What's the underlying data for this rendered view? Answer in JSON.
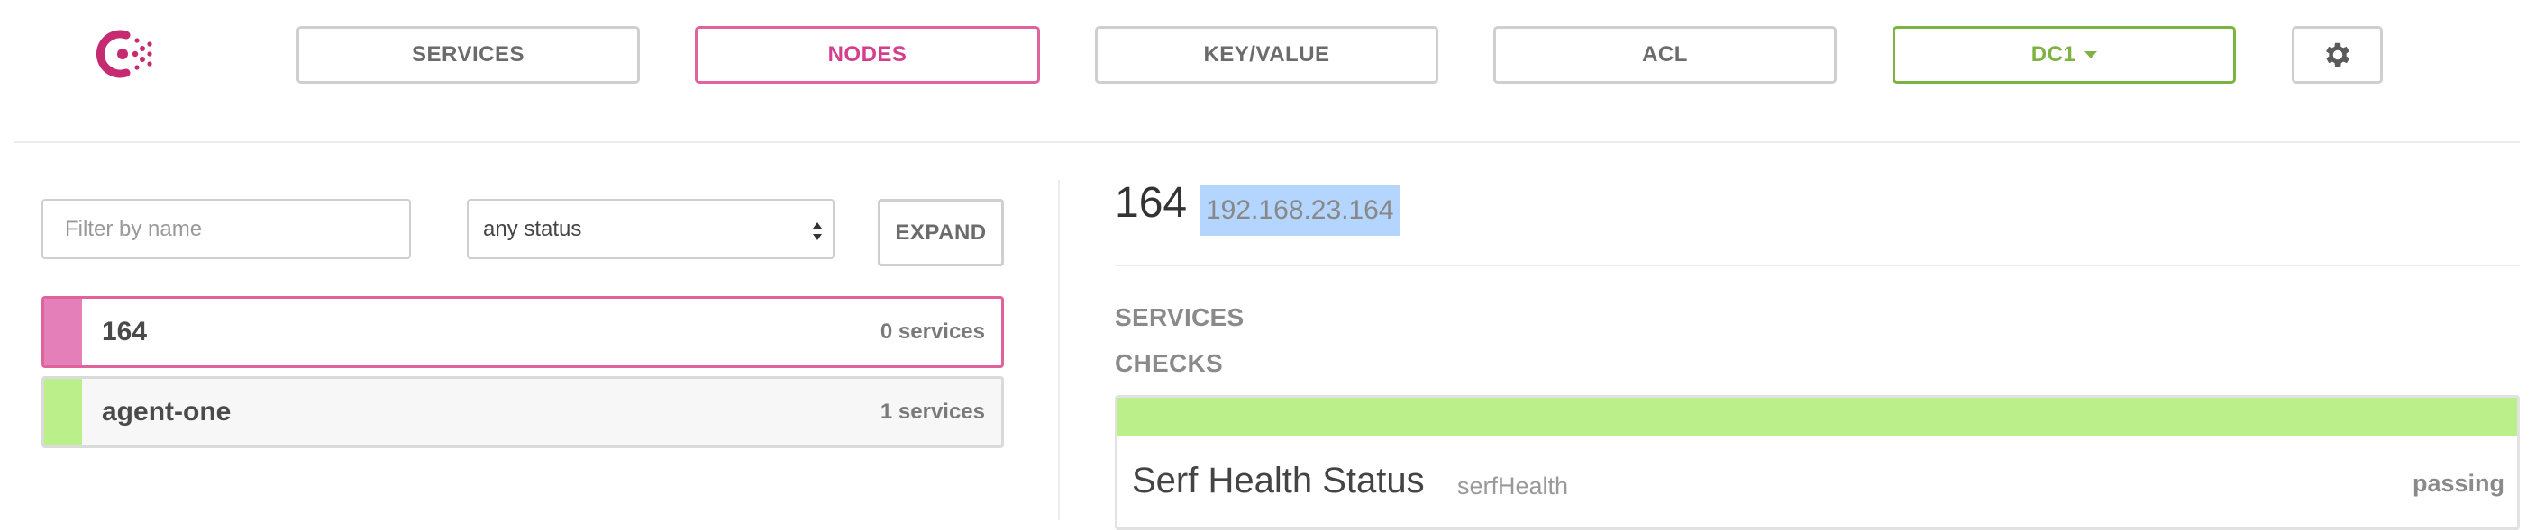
{
  "nav": {
    "logo": "consul-logo",
    "items": [
      {
        "label": "SERVICES",
        "active": false
      },
      {
        "label": "NODES",
        "active": true
      },
      {
        "label": "KEY/VALUE",
        "active": false
      },
      {
        "label": "ACL",
        "active": false
      }
    ],
    "datacenter": "DC1",
    "settings_icon": "gear-icon"
  },
  "sidebar": {
    "filter_placeholder": "Filter by name",
    "filter_value": "",
    "status_selected": "any status",
    "expand_label": "EXPAND",
    "nodes": [
      {
        "name": "164",
        "count": "0 services",
        "status_color": "#e57fb9",
        "active": true
      },
      {
        "name": "agent-one",
        "count": "1 services",
        "status_color": "#bbef89",
        "active": false
      }
    ]
  },
  "detail": {
    "name": "164",
    "address": "192.168.23.164",
    "services_heading": "SERVICES",
    "checks_heading": "CHECKS",
    "checks": [
      {
        "name": "Serf Health Status",
        "id": "serfHealth",
        "status": "passing",
        "status_color": "#bbef89"
      }
    ]
  },
  "colors": {
    "accent": "#d43f8d",
    "datacenter": "#7cb342",
    "passing": "#bbef89",
    "selection": "#b4d5fe"
  }
}
